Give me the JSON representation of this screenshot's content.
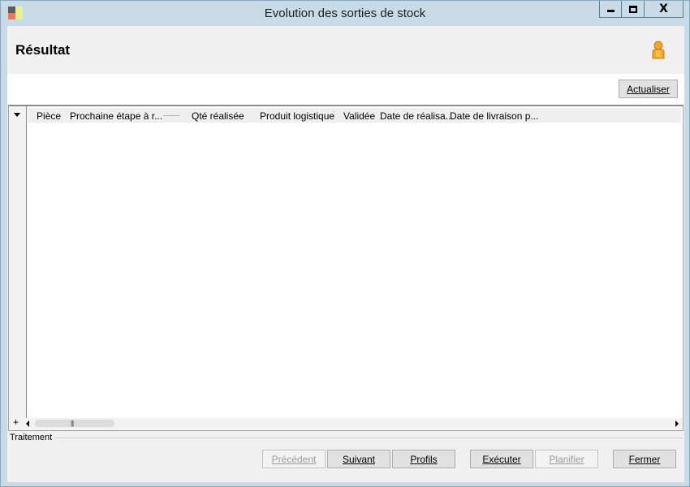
{
  "window": {
    "title": "Evolution des sorties de stock",
    "controls": {
      "minimize": "minimize-icon",
      "maximize": "maximize-icon",
      "close_glyph": "X"
    }
  },
  "header": {
    "title": "Résultat",
    "user_icon": "user-icon"
  },
  "toolbar": {
    "refresh_label": "Actualiser"
  },
  "grid": {
    "columns": [
      "Pièce",
      "Prochaine étape à r...",
      "Qté réalisée",
      "Produit logistique",
      "Validée",
      "Date de réalisa...",
      "Date de livraison p..."
    ],
    "rows": [],
    "add_row_glyph": "+",
    "sort_column": "Prochaine étape à r..."
  },
  "section": {
    "traitement_label": "Traitement"
  },
  "footer": {
    "previous_label": "Précédent",
    "next_label": "Suivant",
    "profiles_label": "Profils",
    "execute_label": "Exécuter",
    "schedule_label": "Planifier",
    "close_label": "Fermer"
  },
  "colors": {
    "frame": "#c9dbe6",
    "client": "#f0f0f0",
    "button": "#e1e1e1",
    "disabled_text": "#9a9a9a"
  }
}
